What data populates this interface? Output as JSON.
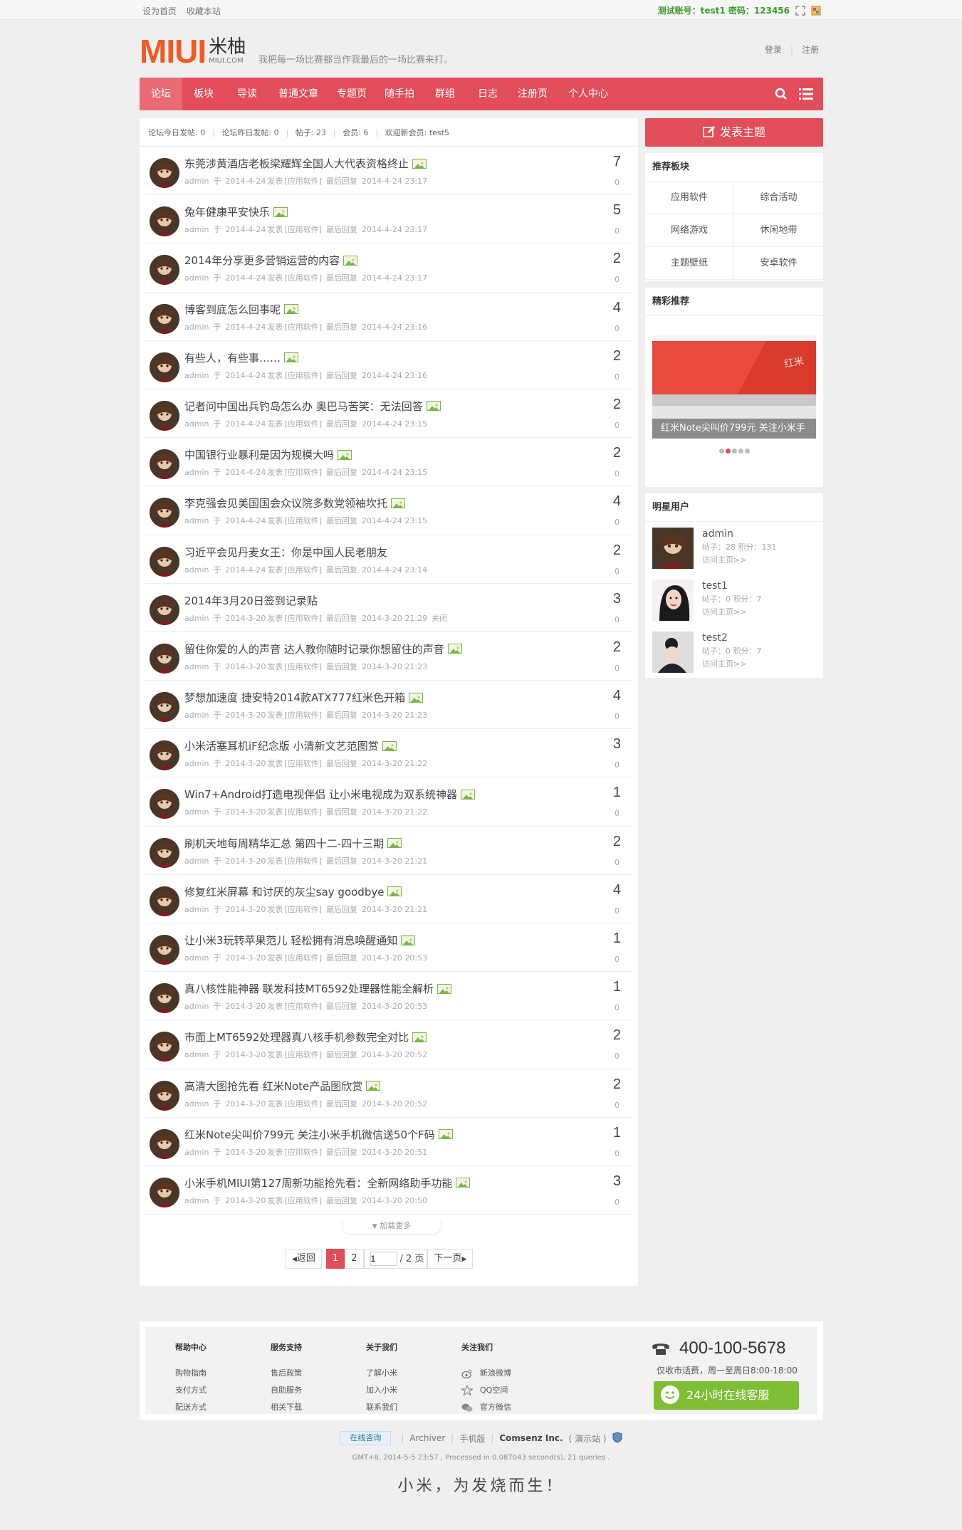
{
  "topbar": {
    "set_home": "设为首页",
    "bookmark": "收藏本站",
    "test_account": "测试账号：test1 密码：123456"
  },
  "header": {
    "logo_mark": "MIUI",
    "logo_cn": "米柚",
    "logo_domain": "MIUI.COM",
    "slogan": "我把每一场比赛都当作我最后的一场比赛来打。",
    "login": "登录",
    "register": "注册"
  },
  "nav": {
    "items": [
      "论坛",
      "板块",
      "导读",
      "普通文章",
      "专题页",
      "随手拍",
      "群组",
      "日志",
      "注册页",
      "个人中心"
    ]
  },
  "stats": {
    "today": "论坛今日发帖: 0",
    "yesterday": "论坛昨日发帖: 0",
    "posts": "帖子: 23",
    "members": "会员: 6",
    "newest": "欢迎新会员: test5"
  },
  "threads": [
    {
      "title": "东莞涉黄酒店老板梁耀辉全国人大代表资格终止",
      "date": "2014-4-24",
      "forum": "[应用软件]",
      "last": "2014-4-24 23:17",
      "replies": "7",
      "views": "0",
      "closed": ""
    },
    {
      "title": "兔年健康平安快乐",
      "date": "2014-4-24",
      "forum": "[应用软件]",
      "last": "2014-4-24 23:17",
      "replies": "5",
      "views": "0",
      "closed": ""
    },
    {
      "title": "2014年分享更多营销运营的内容",
      "date": "2014-4-24",
      "forum": "[应用软件]",
      "last": "2014-4-24 23:17",
      "replies": "2",
      "views": "0",
      "closed": ""
    },
    {
      "title": "博客到底怎么回事呢",
      "date": "2014-4-24",
      "forum": "[应用软件]",
      "last": "2014-4-24 23:16",
      "replies": "4",
      "views": "0",
      "closed": ""
    },
    {
      "title": "有些人，有些事……",
      "date": "2014-4-24",
      "forum": "[应用软件]",
      "last": "2014-4-24 23:16",
      "replies": "2",
      "views": "0",
      "closed": ""
    },
    {
      "title": "记者问中国出兵钓岛怎么办 奥巴马苦笑：无法回答",
      "date": "2014-4-24",
      "forum": "[应用软件]",
      "last": "2014-4-24 23:15",
      "replies": "2",
      "views": "0",
      "closed": ""
    },
    {
      "title": "中国银行业暴利是因为规模大吗",
      "date": "2014-4-24",
      "forum": "[应用软件]",
      "last": "2014-4-24 23:15",
      "replies": "2",
      "views": "0",
      "closed": ""
    },
    {
      "title": "李克强会见美国国会众议院多数党领袖坎托",
      "date": "2014-4-24",
      "forum": "[应用软件]",
      "last": "2014-4-24 23:15",
      "replies": "4",
      "views": "0",
      "closed": ""
    },
    {
      "title": "习近平会见丹麦女王：你是中国人民老朋友",
      "date": "2014-4-24",
      "forum": "[应用软件]",
      "last": "2014-4-24 23:14",
      "replies": "2",
      "views": "0",
      "closed": "",
      "nopic": true
    },
    {
      "title": "2014年3月20日签到记录贴",
      "date": "2014-3-20",
      "forum": "[应用软件]",
      "last": "2014-3-20 21:29",
      "replies": "3",
      "views": "0",
      "closed": "关闭",
      "nopic": true
    },
    {
      "title": "留住你爱的人的声音 达人教你随时记录你想留住的声音",
      "date": "2014-3-20",
      "forum": "[应用软件]",
      "last": "2014-3-20 21:23",
      "replies": "2",
      "views": "0",
      "closed": ""
    },
    {
      "title": "梦想加速度 捷安特2014款ATX777红米色开箱",
      "date": "2014-3-20",
      "forum": "[应用软件]",
      "last": "2014-3-20 21:23",
      "replies": "4",
      "views": "0",
      "closed": ""
    },
    {
      "title": "小米活塞耳机iF纪念版 小清新文艺范图赏",
      "date": "2014-3-20",
      "forum": "[应用软件]",
      "last": "2014-3-20 21:22",
      "replies": "3",
      "views": "0",
      "closed": ""
    },
    {
      "title": "Win7+Android打造电视伴侣 让小米电视成为双系统神器",
      "date": "2014-3-20",
      "forum": "[应用软件]",
      "last": "2014-3-20 21:22",
      "replies": "1",
      "views": "0",
      "closed": ""
    },
    {
      "title": "刷机天地每周精华汇总 第四十二-四十三期",
      "date": "2014-3-20",
      "forum": "[应用软件]",
      "last": "2014-3-20 21:21",
      "replies": "2",
      "views": "0",
      "closed": ""
    },
    {
      "title": "修复红米屏幕 和讨厌的灰尘say goodbye",
      "date": "2014-3-20",
      "forum": "[应用软件]",
      "last": "2014-3-20 21:21",
      "replies": "4",
      "views": "0",
      "closed": ""
    },
    {
      "title": "让小米3玩转苹果范儿 轻松拥有消息唤醒通知",
      "date": "2014-3-20",
      "forum": "[应用软件]",
      "last": "2014-3-20 20:53",
      "replies": "1",
      "views": "0",
      "closed": ""
    },
    {
      "title": "真八核性能神器 联发科技MT6592处理器性能全解析",
      "date": "2014-3-20",
      "forum": "[应用软件]",
      "last": "2014-3-20 20:53",
      "replies": "1",
      "views": "0",
      "closed": ""
    },
    {
      "title": "市面上MT6592处理器真八核手机参数完全对比",
      "date": "2014-3-20",
      "forum": "[应用软件]",
      "last": "2014-3-20 20:52",
      "replies": "2",
      "views": "0",
      "closed": ""
    },
    {
      "title": "高清大图抢先看 红米Note产品图欣赏",
      "date": "2014-3-20",
      "forum": "[应用软件]",
      "last": "2014-3-20 20:52",
      "replies": "2",
      "views": "0",
      "closed": ""
    },
    {
      "title": "红米Note尖叫价799元 关注小米手机微信送50个F码",
      "date": "2014-3-20",
      "forum": "[应用软件]",
      "last": "2014-3-20 20:51",
      "replies": "1",
      "views": "0",
      "closed": ""
    },
    {
      "title": "小米手机MIUI第127周新功能抢先看：全新网络助手功能",
      "date": "2014-3-20",
      "forum": "[应用软件]",
      "last": "2014-3-20 20:50",
      "replies": "3",
      "views": "0",
      "closed": ""
    }
  ],
  "thread_meta": {
    "author": "admin",
    "posted_prefix": "于",
    "posted_suffix": "发表",
    "last_prefix": "最后回复"
  },
  "loadmore": "加载更多",
  "pager": {
    "back": "返回",
    "current": "1",
    "next_page": "2",
    "input": "1",
    "total": "/ 2 页",
    "next": "下一页"
  },
  "side": {
    "post_button": "发表主题",
    "forums_title": "推荐板块",
    "forums": [
      "应用软件",
      "综合活动",
      "网络游戏",
      "休闲地带",
      "主题壁纸",
      "安卓软件"
    ],
    "featured_title": "精彩推荐",
    "slide_caption": "红米Note尖叫价799元 关注小米手",
    "stars_title": "明星用户",
    "users": [
      {
        "name": "admin",
        "stats": "帖子：28 积分：131",
        "visit": "访问主页>>"
      },
      {
        "name": "test1",
        "stats": "帖子：0 积分：7",
        "visit": "访问主页>>"
      },
      {
        "name": "test2",
        "stats": "帖子：0 积分：7",
        "visit": "访问主页>>"
      }
    ]
  },
  "footer": {
    "cols": [
      {
        "title": "帮助中心",
        "links": [
          "购物指南",
          "支付方式",
          "配送方式"
        ]
      },
      {
        "title": "服务支持",
        "links": [
          "售后政策",
          "自助服务",
          "相关下载"
        ]
      },
      {
        "title": "关于我们",
        "links": [
          "了解小米",
          "加入小米",
          "联系我们"
        ]
      },
      {
        "title": "关注我们",
        "links": [
          "新浪微博",
          "QQ空间",
          "官方微信"
        ]
      }
    ],
    "phone": "400-100-5678",
    "phone_note": "仅收市话费，周一至周日8:00-18:00",
    "online": "24小时在线客服"
  },
  "bottom": {
    "consult": "在线咨询",
    "archiver": "Archiver",
    "mobile": "手机版",
    "company": "Comsenz Inc.",
    "demo": "( 演示站 )",
    "powered": "GMT+8, 2014-5-5 23:57 , Processed in 0.087043 second(s), 21 queries .",
    "motto": "小米，为发烧而生！"
  },
  "colors": {
    "accent": "#e14d59",
    "logo": "#f15a24",
    "online": "#7dbe35"
  }
}
